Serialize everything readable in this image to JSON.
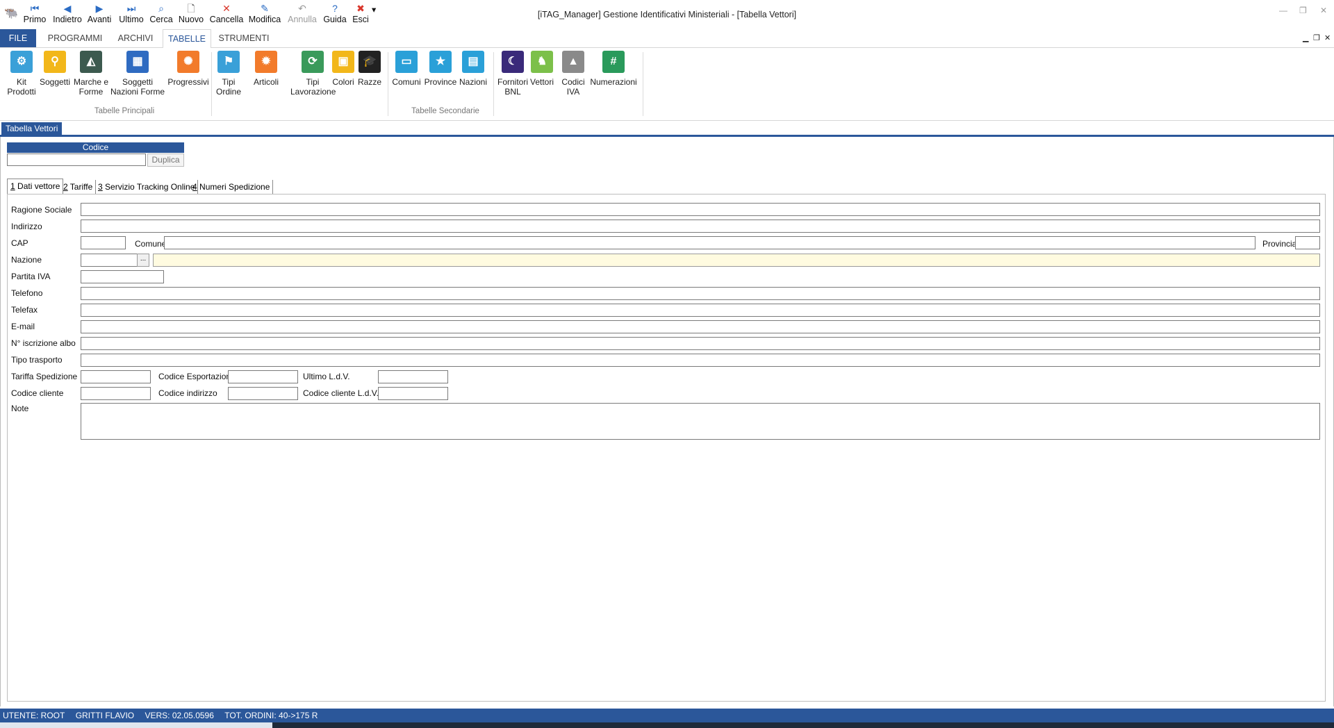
{
  "window": {
    "title": "[iTAG_Manager] Gestione Identificativi Ministeriali - [Tabella Vettori]"
  },
  "quick_access": [
    {
      "label": "Primo",
      "icon": "first-record-icon",
      "glyph": "⏮",
      "color": "#2b6cc4"
    },
    {
      "label": "Indietro",
      "icon": "previous-record-icon",
      "glyph": "◀",
      "color": "#2b6cc4"
    },
    {
      "label": "Avanti",
      "icon": "next-record-icon",
      "glyph": "▶",
      "color": "#2b6cc4"
    },
    {
      "label": "Ultimo",
      "icon": "last-record-icon",
      "glyph": "⏭",
      "color": "#2b6cc4"
    },
    {
      "label": "Cerca",
      "icon": "binoculars-icon",
      "glyph": "⌕",
      "color": "#2b6cc4"
    },
    {
      "label": "Nuovo",
      "icon": "new-document-icon",
      "glyph": "🗋",
      "color": "#555555"
    },
    {
      "label": "Cancella",
      "icon": "delete-icon",
      "glyph": "✕",
      "color": "#d9362b"
    },
    {
      "label": "Modifica",
      "icon": "edit-icon",
      "glyph": "✎",
      "color": "#2b6cc4"
    },
    {
      "label": "Annulla",
      "icon": "undo-icon",
      "glyph": "↶",
      "color": "#9a9a9a",
      "disabled": true
    },
    {
      "label": "Guida",
      "icon": "help-icon",
      "glyph": "?",
      "color": "#2b6cc4"
    },
    {
      "label": "Esci",
      "icon": "exit-icon",
      "glyph": "✖",
      "color": "#d9362b"
    }
  ],
  "ribbon_tabs": [
    "FILE",
    "PROGRAMMI",
    "ARCHIVI",
    "TABELLE",
    "STRUMENTI"
  ],
  "ribbon": {
    "groups": [
      "Tabelle Principali",
      "Tabelle Secondarie"
    ],
    "buttons": [
      {
        "line1": "Kit",
        "line2": "Prodotti",
        "icon": "kit-prodotti-icon",
        "color": "#3aa0d8",
        "glyph": "⚙"
      },
      {
        "line1": "Soggetti",
        "line2": "",
        "icon": "soggetti-icon",
        "color": "#f2b71a",
        "glyph": "⚲"
      },
      {
        "line1": "Marche e",
        "line2": "Forme",
        "icon": "marche-forme-icon",
        "color": "#3c5a4f",
        "glyph": "◭"
      },
      {
        "line1": "Soggetti",
        "line2": "Nazioni Forme",
        "icon": "soggetti-nazioni-forme-icon",
        "color": "#2f6bc1",
        "glyph": "▦"
      },
      {
        "line1": "Progressivi",
        "line2": "",
        "icon": "progressivi-icon",
        "color": "#f27b2b",
        "glyph": "✺"
      },
      {
        "line1": "Tipi",
        "line2": "Ordine",
        "icon": "tipi-ordine-icon",
        "color": "#3aa0d8",
        "glyph": "⚑"
      },
      {
        "line1": "Articoli",
        "line2": "",
        "icon": "articoli-icon",
        "color": "#f27b2b",
        "glyph": "✹"
      },
      {
        "line1": "Tipi",
        "line2": "Lavorazione",
        "icon": "tipi-lavorazione-icon",
        "color": "#3a9a5b",
        "glyph": "⟳"
      },
      {
        "line1": "Colori",
        "line2": "",
        "icon": "colori-icon",
        "color": "#f2b71a",
        "glyph": "▣"
      },
      {
        "line1": "Razze",
        "line2": "",
        "icon": "razze-icon",
        "color": "#222222",
        "glyph": "🎓"
      },
      {
        "line1": "Comuni",
        "line2": "",
        "icon": "comuni-icon",
        "color": "#2aa0d8",
        "glyph": "▭"
      },
      {
        "line1": "Province",
        "line2": "",
        "icon": "province-icon",
        "color": "#2aa0d8",
        "glyph": "★"
      },
      {
        "line1": "Nazioni",
        "line2": "",
        "icon": "nazioni-icon",
        "color": "#2aa0d8",
        "glyph": "▤"
      },
      {
        "line1": "Fornitori",
        "line2": "BNL",
        "icon": "fornitori-bnl-icon",
        "color": "#3a2a7a",
        "glyph": "☾"
      },
      {
        "line1": "Vettori",
        "line2": "",
        "icon": "vettori-icon",
        "color": "#7cc04a",
        "glyph": "♞"
      },
      {
        "line1": "Codici",
        "line2": "IVA",
        "icon": "codici-iva-icon",
        "color": "#8a8a8a",
        "glyph": "▲"
      },
      {
        "line1": "Numerazioni",
        "line2": "",
        "icon": "numerazioni-icon",
        "color": "#2a9a5b",
        "glyph": "#"
      }
    ]
  },
  "document": {
    "tab_label": "Tabella Vettori",
    "codice_header": "Codice",
    "codice_value": "",
    "duplica_label": "Duplica"
  },
  "subtabs": [
    {
      "key": "1",
      "label": " Dati vettore"
    },
    {
      "key": "2",
      "label": " Tariffe"
    },
    {
      "key": "3",
      "label": " Servizio Tracking Online"
    },
    {
      "key": "4",
      "label": " Numeri Spedizione"
    }
  ],
  "form": {
    "ragione_sociale": "Ragione Sociale",
    "indirizzo": "Indirizzo",
    "cap": "CAP",
    "comune": "Comune",
    "provincia": "Provincia",
    "nazione": "Nazione",
    "nazione_lookup": "...",
    "partita_iva": "Partita IVA",
    "telefono": "Telefono",
    "telefax": "Telefax",
    "email": "E-mail",
    "iscrizione_albo": "N° iscrizione albo",
    "tipo_trasporto": "Tipo trasporto",
    "tariffa_spedizione": "Tariffa Spedizione",
    "codice_esportazione": "Codice Esportazione",
    "ultimo_ldv": "Ultimo L.d.V.",
    "codice_cliente": "Codice cliente",
    "codice_indirizzo": "Codice indirizzo",
    "codice_cliente_ldv": "Codice cliente L.d.V.",
    "note": "Note"
  },
  "status": {
    "utente": "UTENTE: ROOT",
    "nome": "GRITTI FLAVIO",
    "versione": "VERS: 02.05.0596",
    "ordini": "TOT. ORDINI: 40->175 R"
  },
  "colors": {
    "accent": "#2b579a",
    "lookup_field": "#fffbe0"
  }
}
